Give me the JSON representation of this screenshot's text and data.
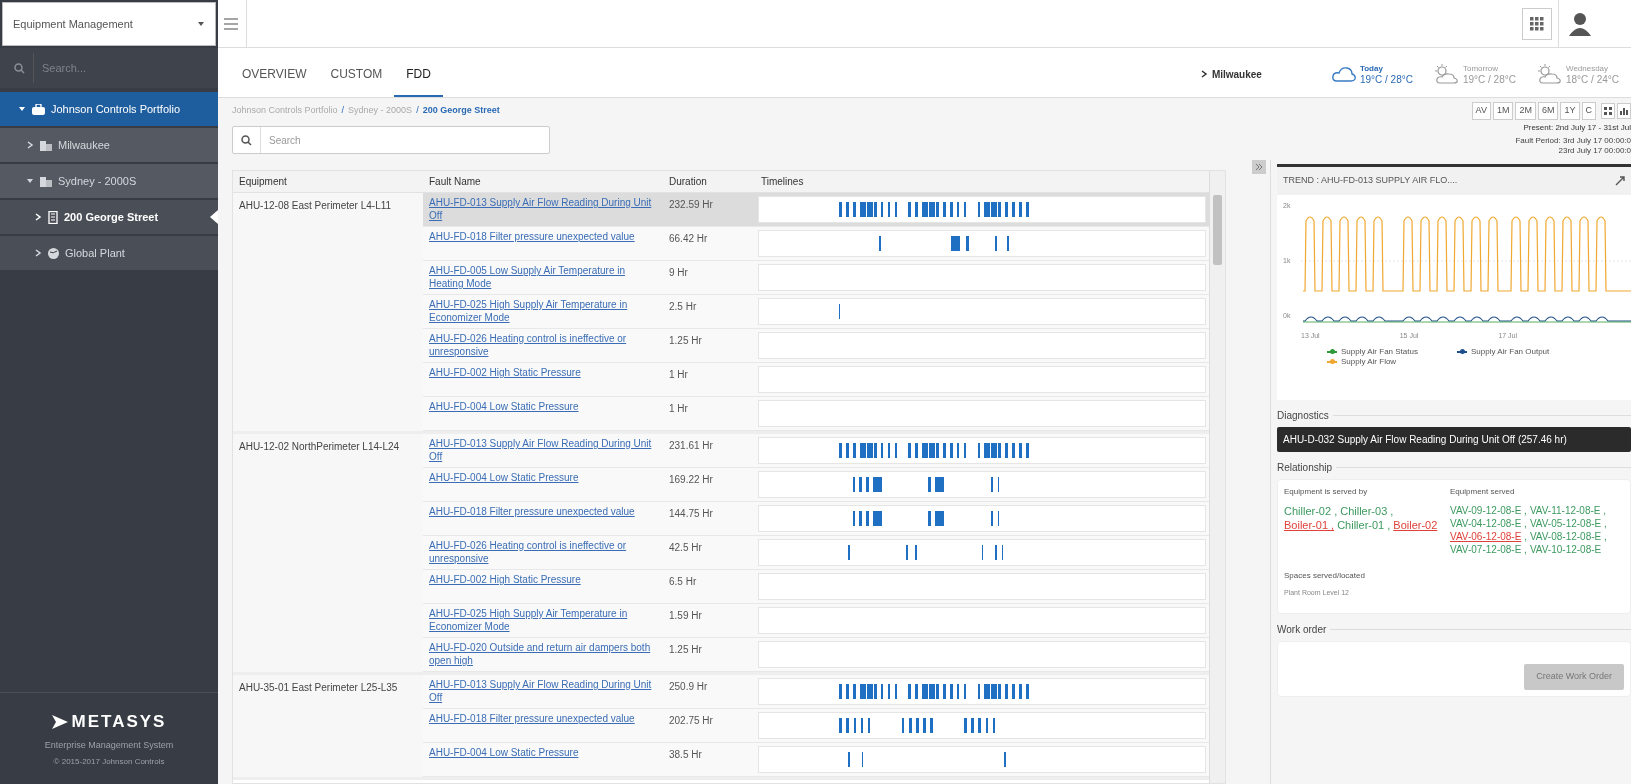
{
  "sidebar": {
    "module_select": "Equipment Management",
    "search": {
      "placeholder": "Search..."
    },
    "tree": [
      {
        "label": "Johnson Controls Portfolio",
        "kind": "portfolio",
        "expanded": true,
        "selected": true,
        "active": false,
        "children": [
          {
            "label": "Milwaukee",
            "kind": "building",
            "expanded": false,
            "selected": false,
            "active": false
          },
          {
            "label": "Sydney - 2000S",
            "kind": "building",
            "expanded": true,
            "selected": false,
            "active": false,
            "children": [
              {
                "label": "200 George Street",
                "kind": "tower",
                "expanded": false,
                "selected": false,
                "active": true
              },
              {
                "label": "Global Plant",
                "kind": "globe",
                "expanded": false,
                "selected": false,
                "active": false
              }
            ]
          }
        ]
      }
    ],
    "logo": "METASYS",
    "tagline": "Enterprise Management System",
    "copyright": "© 2015-2017 Johnson Controls"
  },
  "tabs": [
    {
      "label": "OVERVIEW",
      "selected": false
    },
    {
      "label": "CUSTOM",
      "selected": false
    },
    {
      "label": "FDD",
      "selected": true
    }
  ],
  "location": "Milwaukee",
  "weather": [
    {
      "day": "Today",
      "temps": "19°C / 28°C",
      "kind": "cloud"
    },
    {
      "day": "Tomorrow",
      "temps": "19°C / 28°C",
      "kind": "sun-cloud"
    },
    {
      "day": "Wednesday",
      "temps": "18°C / 24°C",
      "kind": "sun-cloud"
    }
  ],
  "breadcrumb": [
    {
      "label": "Johnson Controls Portfolio",
      "kind": "link"
    },
    {
      "label": "/",
      "kind": "separator"
    },
    {
      "label": "Sydney - 2000S",
      "kind": "link"
    },
    {
      "label": "/",
      "kind": "separator"
    },
    {
      "label": "200 George Street",
      "kind": "current"
    }
  ],
  "search": {
    "placeholder": "Search"
  },
  "range_buttons": [
    "AV",
    "1M",
    "2M",
    "6M",
    "1Y",
    "C"
  ],
  "period": {
    "present": "Present: 2nd July 17 - 31st Jul",
    "fault_period": [
      "Fault Period: 3rd July 17 00:00:0",
      "23rd July 17 00:00:0"
    ]
  },
  "table": {
    "columns": [
      "Equipment",
      "Fault Name",
      "Duration",
      "Timelines"
    ],
    "groups": [
      {
        "equipment": "AHU-12-08 East Perimeter L4-L11",
        "faults": [
          {
            "name": "AHU-FD-013 Supply Air Flow Reading During Unit Off",
            "duration": "232.59 Hr",
            "selected": true
          },
          {
            "name": "AHU-FD-018 Filter pressure unexpected value",
            "duration": "66.42 Hr",
            "selected": false
          },
          {
            "name": "AHU-FD-005 Low Supply Air Temperature in Heating Mode",
            "duration": "9 Hr",
            "selected": false
          },
          {
            "name": "AHU-FD-025 High Supply Air Temperature in Economizer Mode",
            "duration": "2.5 Hr",
            "selected": false
          },
          {
            "name": "AHU-FD-026 Heating control is ineffective or unresponsive",
            "duration": "1.25 Hr",
            "selected": false
          },
          {
            "name": "AHU-FD-002 High Static Pressure",
            "duration": "1 Hr",
            "selected": false
          },
          {
            "name": "AHU-FD-004 Low Static Pressure",
            "duration": "1 Hr",
            "selected": false
          }
        ]
      },
      {
        "equipment": "AHU-12-02 NorthPerimeter L14-L24",
        "faults": [
          {
            "name": "AHU-FD-013 Supply Air Flow Reading During Unit Off",
            "duration": "231.61 Hr",
            "selected": false
          },
          {
            "name": "AHU-FD-004 Low Static Pressure",
            "duration": "169.22 Hr",
            "selected": false
          },
          {
            "name": "AHU-FD-018 Filter pressure unexpected value",
            "duration": "144.75 Hr",
            "selected": false
          },
          {
            "name": "AHU-FD-026 Heating control is ineffective or unresponsive",
            "duration": "42.5 Hr",
            "selected": false
          },
          {
            "name": "AHU-FD-002 High Static Pressure",
            "duration": "6.5 Hr",
            "selected": false
          },
          {
            "name": "AHU-FD-025 High Supply Air Temperature in Economizer Mode",
            "duration": "1.59 Hr",
            "selected": false
          },
          {
            "name": "AHU-FD-020 Outside and return air dampers both open high",
            "duration": "1.25 Hr",
            "selected": false
          }
        ]
      },
      {
        "equipment": "AHU-35-01 East Perimeter L25-L35",
        "faults": [
          {
            "name": "AHU-FD-013 Supply Air Flow Reading During Unit Off",
            "duration": "250.9 Hr",
            "selected": false
          },
          {
            "name": "AHU-FD-018 Filter pressure unexpected value",
            "duration": "202.75 Hr",
            "selected": false
          },
          {
            "name": "AHU-FD-004 Low Static Pressure",
            "duration": "38.5 Hr",
            "selected": false
          }
        ]
      }
    ]
  },
  "trend": {
    "title": "TREND : AHU-FD-013 SUPPLY AIR FLO....",
    "y_labels": [
      "2k",
      "1k",
      "0k"
    ],
    "x_labels": [
      "13 Jul",
      "15 Jul",
      "17 Jul"
    ],
    "legend": [
      {
        "label": "Supply Air Fan Status",
        "color": "#2e9b3a"
      },
      {
        "label": "Supply Air Fan Output",
        "color": "#1f4e8c"
      },
      {
        "label": "Supply Air Flow",
        "color": "#f0a830"
      }
    ]
  },
  "diagnostics": {
    "title": "Diagnostics",
    "fault": "AHU-D-032 Supply Air Flow Reading During Unit Off (257.46 hr)"
  },
  "relationship": {
    "title": "Relationship",
    "served_by": {
      "label": "Equipment is served by",
      "items": [
        {
          "name": "Chiller-02 ,",
          "color": "#3c9a5f"
        },
        {
          "name": "Chiller-03 ,",
          "color": "#3c9a5f"
        },
        {
          "name": "Boiler-01 ,",
          "color": "#e0413a"
        },
        {
          "name": "Chiller-01 ,",
          "color": "#3c9a5f"
        },
        {
          "name": "Boiler-02",
          "color": "#e0413a"
        }
      ]
    },
    "served": {
      "label": "Equipment served",
      "items": [
        {
          "name": "VAV-09-12-08-E ,",
          "color": "#3c9a5f"
        },
        {
          "name": "VAV-11-12-08-E ,",
          "color": "#3c9a5f"
        },
        {
          "name": "VAV-04-12-08-E ,",
          "color": "#3c9a5f"
        },
        {
          "name": "VAV-05-12-08-E ,",
          "color": "#3c9a5f"
        },
        {
          "name": "VAV-06-12-08-E",
          "color": "#e0413a"
        },
        {
          "name": ", VAV-08-12-08-E ,",
          "color": "#3c9a5f"
        },
        {
          "name": "VAV-07-12-08-E ,",
          "color": "#3c9a5f"
        },
        {
          "name": "VAV-10-12-08-E",
          "color": "#3c9a5f"
        }
      ]
    },
    "spaces": {
      "label": "Spaces served/located",
      "value": "Plant Room Level 12"
    }
  },
  "work_order": {
    "title": "Work order",
    "button": {
      "label": "Create Work Order",
      "disabled": true
    }
  }
}
